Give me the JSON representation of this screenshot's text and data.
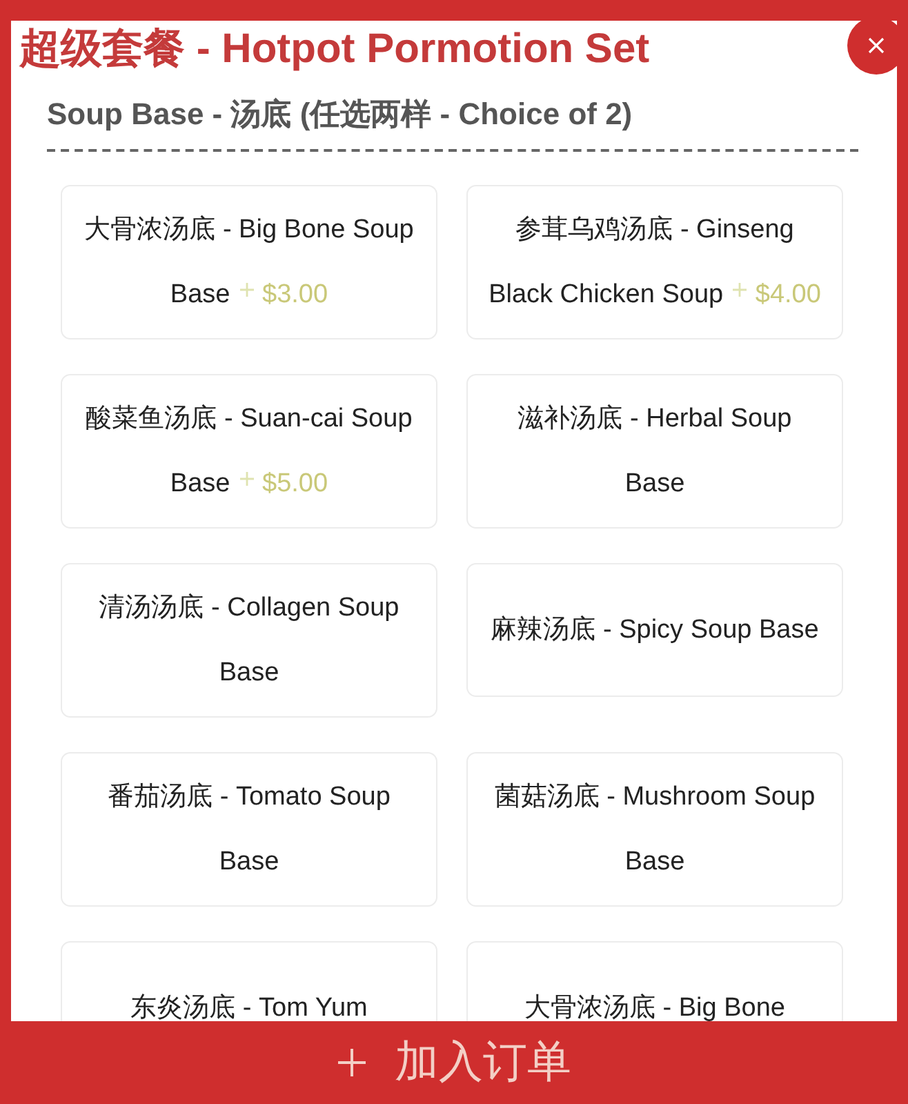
{
  "dialog": {
    "title": "超级套餐 - Hotpot Pormotion Set"
  },
  "section": {
    "heading": "Soup Base - 汤底 (任选两样 - Choice of 2)"
  },
  "options": [
    {
      "name": "大骨浓汤底 - Big Bone Soup Base",
      "price": "$3.00",
      "selected": false
    },
    {
      "name": "参茸乌鸡汤底 - Ginseng Black Chicken Soup",
      "price": "$4.00",
      "selected": false
    },
    {
      "name": "酸菜鱼汤底 - Suan-cai Soup Base",
      "price": "$5.00",
      "selected": false
    },
    {
      "name": "滋补汤底 - Herbal Soup Base",
      "selected": false
    },
    {
      "name": "清汤汤底 - Collagen Soup Base",
      "selected": false
    },
    {
      "name": "麻辣汤底 - Spicy Soup Base",
      "selected": false
    },
    {
      "name": "番茄汤底 - Tomato Soup Base",
      "selected": false
    },
    {
      "name": "菌菇汤底 - Mushroom Soup Base",
      "selected": false
    },
    {
      "name": "东炎汤底 - Tom Yum",
      "selected": false
    },
    {
      "name": "大骨浓汤底 - Big Bone",
      "selected": false
    }
  ],
  "footer": {
    "label": "加入订单"
  }
}
